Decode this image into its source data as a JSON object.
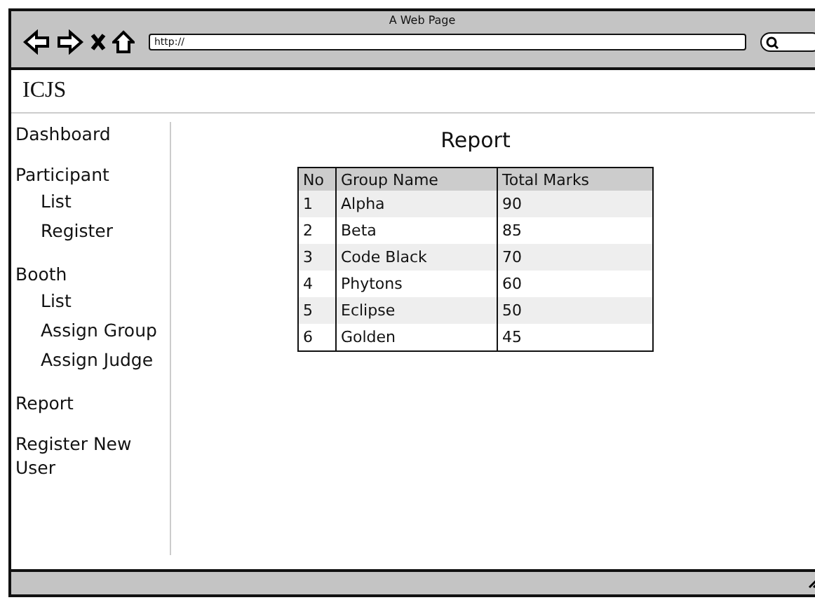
{
  "window": {
    "title": "A Web Page"
  },
  "address_bar": {
    "placeholder": "http://"
  },
  "site_title": "ICJS",
  "sidebar": {
    "items": [
      {
        "label": "Dashboard"
      },
      {
        "label": "Participant",
        "children": [
          {
            "label": "List"
          },
          {
            "label": "Register"
          }
        ]
      },
      {
        "label": "Booth",
        "children": [
          {
            "label": "List"
          },
          {
            "label": "Assign Group"
          },
          {
            "label": "Assign Judge"
          }
        ]
      },
      {
        "label": "Report"
      },
      {
        "label": "Register New User"
      }
    ]
  },
  "content": {
    "heading": "Report",
    "table": {
      "columns": [
        "No",
        "Group Name",
        "Total Marks"
      ],
      "rows": [
        [
          "1",
          "Alpha",
          "90"
        ],
        [
          "2",
          "Beta",
          "85"
        ],
        [
          "3",
          "Code Black",
          "70"
        ],
        [
          "4",
          "Phytons",
          "60"
        ],
        [
          "5",
          "Eclipse",
          "50"
        ],
        [
          "6",
          "Golden",
          "45"
        ]
      ]
    }
  }
}
